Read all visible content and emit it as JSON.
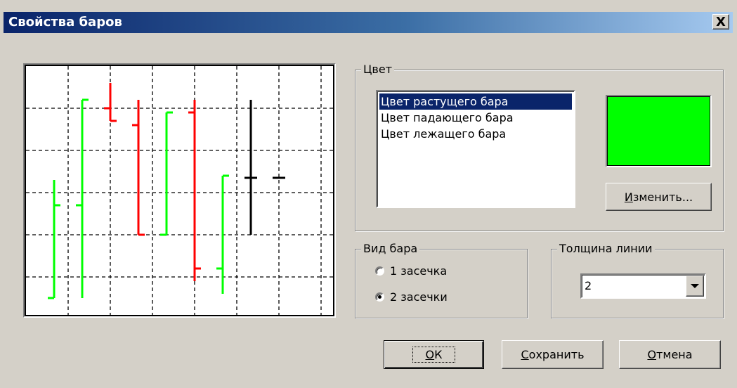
{
  "window": {
    "title": "Свойства баров",
    "close_label": "X"
  },
  "color_group": {
    "legend": "Цвет",
    "items": [
      "Цвет растущего бара",
      "Цвет падающего бара",
      "Цвет лежащего бара"
    ],
    "selected_index": 0,
    "swatch_color": "#00ff00",
    "change_button": {
      "label_underline": "И",
      "label_rest": "зменить..."
    }
  },
  "bar_type_group": {
    "legend": "Вид бара",
    "options": [
      "1 засечка",
      "2 засечки"
    ],
    "selected_index": 1
  },
  "line_width_group": {
    "legend": "Толщина линии",
    "value": "2"
  },
  "buttons": {
    "ok": {
      "label_underline": "О",
      "label_rest": "К"
    },
    "save": {
      "label_underline": "С",
      "label_rest": "охранить"
    },
    "cancel": {
      "label_underline": "О",
      "label_rest": "тмена"
    }
  },
  "colors": {
    "rising": "#00ff00",
    "falling": "#ff0000",
    "flat": "#000000",
    "selection": "#0a246a"
  },
  "chart_data": {
    "type": "ohlc",
    "bars": [
      {
        "color": "rising",
        "high": 3.3,
        "low": 0.5,
        "open": 0.5,
        "close": 2.7
      },
      {
        "color": "rising",
        "high": 5.2,
        "low": 0.5,
        "open": 2.7,
        "close": 5.2
      },
      {
        "color": "falling",
        "high": 5.6,
        "low": 4.7,
        "open": 5.0,
        "close": 4.7
      },
      {
        "color": "falling",
        "high": 5.2,
        "low": 2.0,
        "open": 4.6,
        "close": 2.0
      },
      {
        "color": "rising",
        "high": 4.9,
        "low": 2.0,
        "open": 2.0,
        "close": 4.9
      },
      {
        "color": "falling",
        "high": 5.2,
        "low": 0.9,
        "open": 4.9,
        "close": 1.2
      },
      {
        "color": "rising",
        "high": 3.4,
        "low": 0.6,
        "open": 1.2,
        "close": 3.4
      },
      {
        "color": "flat",
        "high": 5.2,
        "low": 2.0,
        "open": 3.35,
        "close": 3.35
      },
      {
        "color": "flat",
        "high": 3.35,
        "low": 3.35,
        "open": 3.35,
        "close": 3.35
      }
    ]
  }
}
